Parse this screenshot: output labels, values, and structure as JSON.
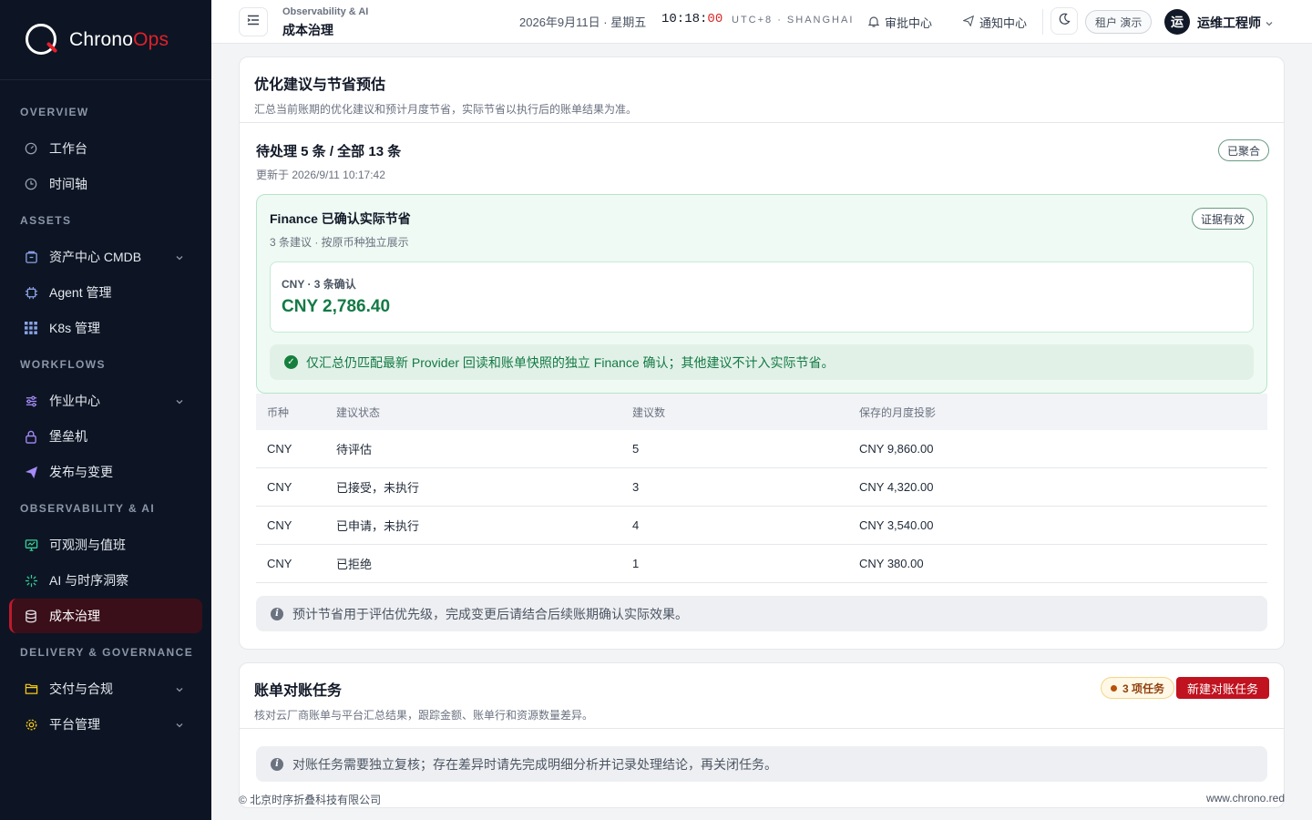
{
  "brand": {
    "name_primary": "Chrono",
    "name_accent": "Ops"
  },
  "sidebar": {
    "sections": [
      {
        "title": "OVERVIEW",
        "items": [
          {
            "label": "工作台",
            "icon": "gauge-icon"
          },
          {
            "label": "时间轴",
            "icon": "clock-icon"
          }
        ]
      },
      {
        "title": "ASSETS",
        "items": [
          {
            "label": "资产中心 CMDB",
            "icon": "cabinet-icon",
            "expandable": true
          },
          {
            "label": "Agent 管理",
            "icon": "chip-icon"
          },
          {
            "label": "K8s 管理",
            "icon": "grid-icon"
          }
        ]
      },
      {
        "title": "WORKFLOWS",
        "items": [
          {
            "label": "作业中心",
            "icon": "sliders-icon",
            "expandable": true
          },
          {
            "label": "堡垒机",
            "icon": "lock-icon"
          },
          {
            "label": "发布与变更",
            "icon": "send-icon"
          }
        ]
      },
      {
        "title": "OBSERVABILITY & AI",
        "items": [
          {
            "label": "可观测与值班",
            "icon": "monitor-icon"
          },
          {
            "label": "AI 与时序洞察",
            "icon": "sparkle-icon"
          },
          {
            "label": "成本治理",
            "icon": "database-icon",
            "active": true
          }
        ]
      },
      {
        "title": "DELIVERY & GOVERNANCE",
        "items": [
          {
            "label": "交付与合规",
            "icon": "folder-icon",
            "expandable": true
          },
          {
            "label": "平台管理",
            "icon": "gear-icon",
            "expandable": true
          }
        ]
      }
    ]
  },
  "topbar": {
    "breadcrumb_parent": "Observability & AI",
    "page_title": "成本治理",
    "date": "2026年9月11日 · 星期五",
    "time_hm": "10:18:",
    "time_sec": "00",
    "timezone": "UTC+8 · SHANGHAI",
    "approval": "审批中心",
    "notifications": "通知中心",
    "tenant": "租户 演示",
    "avatar_char": "运",
    "username": "运维工程师"
  },
  "card1": {
    "title": "优化建议与节省预估",
    "subtitle": "汇总当前账期的优化建议和预计月度节省，实际节省以执行后的账单结果为准。",
    "pending": "待处理 5 条 / 全部 13 条",
    "updated": "更新于 2026/9/11 10:17:42",
    "aggregated_badge": "已聚合",
    "finance": {
      "title": "Finance 已确认实际节省",
      "subtitle": "3 条建议 · 按原币种独立展示",
      "evidence_badge": "证据有效",
      "currency_label": "CNY · 3 条确认",
      "currency_value": "CNY 2,786.40",
      "note": "仅汇总仍匹配最新 Provider 回读和账单快照的独立 Finance 确认；其他建议不计入实际节省。"
    },
    "table": {
      "headers": [
        "币种",
        "建议状态",
        "建议数",
        "保存的月度投影"
      ],
      "rows": [
        [
          "CNY",
          "待评估",
          "5",
          "CNY 9,860.00"
        ],
        [
          "CNY",
          "已接受，未执行",
          "3",
          "CNY 4,320.00"
        ],
        [
          "CNY",
          "已申请，未执行",
          "4",
          "CNY 3,540.00"
        ],
        [
          "CNY",
          "已拒绝",
          "1",
          "CNY 380.00"
        ]
      ]
    },
    "note": "预计节省用于评估优先级，完成变更后请结合后续账期确认实际效果。"
  },
  "card2": {
    "title": "账单对账任务",
    "subtitle": "核对云厂商账单与平台汇总结果，跟踪金额、账单行和资源数量差异。",
    "tasks_badge": "3 项任务",
    "new_button": "新建对账任务",
    "note": "对账任务需要独立复核；存在差异时请先完成明细分析并记录处理结论，再关闭任务。"
  },
  "footer": {
    "copyright": "© 北京时序折叠科技有限公司",
    "site": "www.chrono.red"
  },
  "colors": {
    "sidebar_bg": "#0d1524",
    "accent": "#c0121f",
    "success": "#137a45"
  }
}
